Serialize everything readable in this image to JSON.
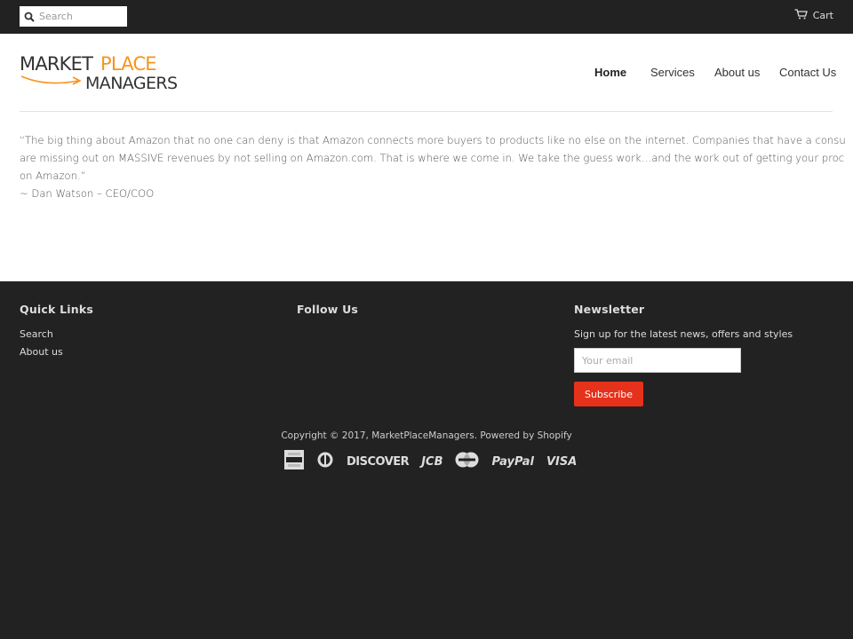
{
  "topbar": {
    "search_placeholder": "Search",
    "cart_label": "Cart"
  },
  "header": {
    "logo_line1_a": "MARKET",
    "logo_line1_b": "PLACE",
    "logo_line2": "MANAGERS",
    "nav": [
      {
        "label": "Home",
        "active": true
      },
      {
        "label": "Services"
      },
      {
        "label": "About us"
      },
      {
        "label": "Contact Us"
      }
    ]
  },
  "content": {
    "quote_line1": "“The big thing about Amazon that no one can deny is that Amazon connects more buyers to products like no else on the internet. Companies that have a consu",
    "quote_line2": "are missing out on MASSIVE revenues by not selling on Amazon.com. That is where we come in. We take the guess work…and the work out of getting your proc",
    "quote_line3": "on Amazon.”",
    "attribution": "~ Dan Watson – CEO/COO"
  },
  "footer": {
    "quick_links_title": "Quick Links",
    "quick_links": [
      "Search",
      "About us"
    ],
    "follow_title": "Follow Us",
    "newsletter_title": "Newsletter",
    "newsletter_text": "Sign up for the latest news, offers and styles",
    "email_placeholder": "Your email",
    "subscribe_label": "Subscribe",
    "copyright_prefix": "Copyright © 2017, ",
    "copyright_brand": "MarketPlaceManagers",
    "copyright_sep": ". ",
    "powered_by": "Powered by Shopify",
    "payments": [
      "DISCOVER",
      "JCB",
      "PayPal",
      "VISA"
    ]
  },
  "colors": {
    "dark": "#222222",
    "accent_orange": "#f7941d",
    "subscribe_red": "#e6311b"
  }
}
